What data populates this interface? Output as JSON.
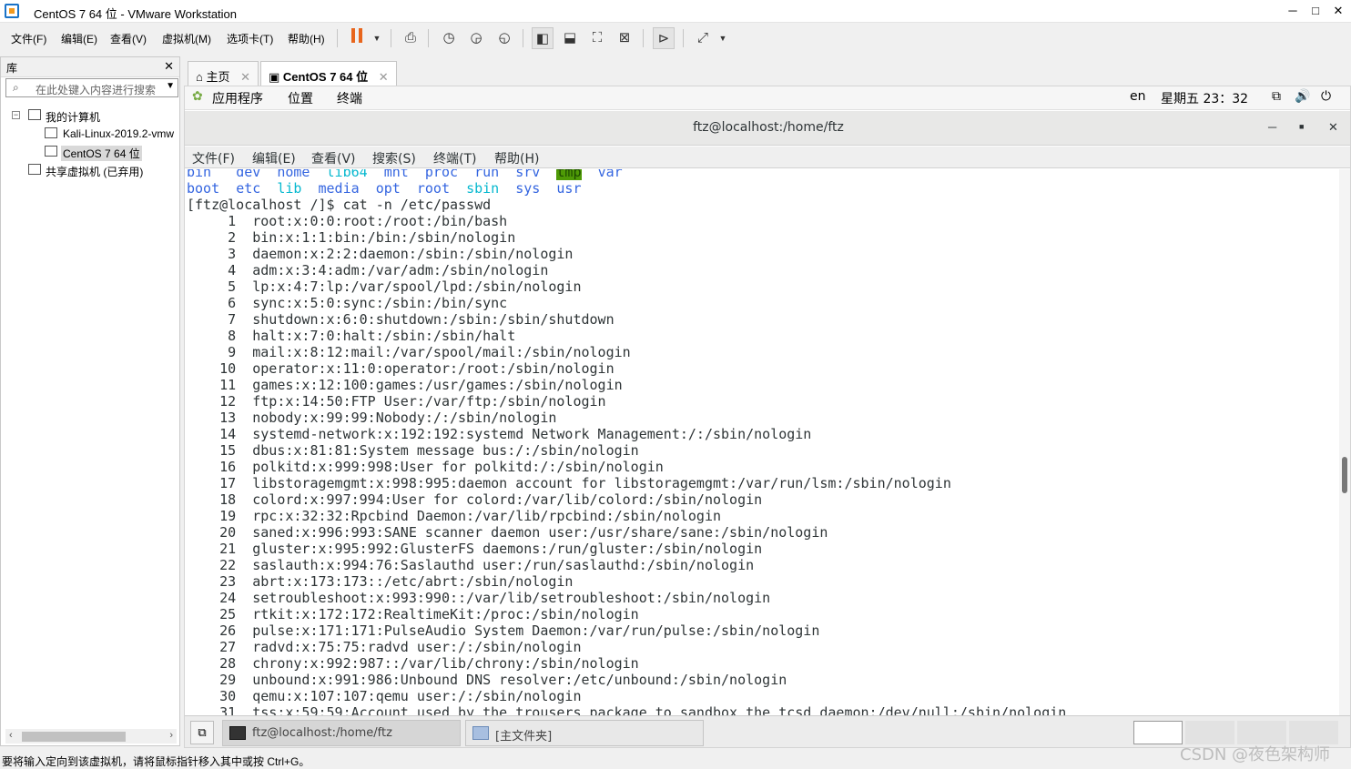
{
  "window": {
    "title": "CentOS 7 64 位 - VMware Workstation"
  },
  "menubar": {
    "items": [
      "文件(F)",
      "编辑(E)",
      "查看(V)",
      "虚拟机(M)",
      "选项卡(T)",
      "帮助(H)"
    ]
  },
  "toolbar": {
    "icons": [
      "pause-icon",
      "dropdown-icon",
      "send-ctrl-alt-del-icon",
      "snapshot-icon",
      "revert-snapshot-icon",
      "snapshot-manager-icon",
      "library-view-icon",
      "thumbnail-view-icon",
      "fullscreen-icon",
      "unity-icon",
      "console-view-icon",
      "stretch-icon",
      "dropdown-icon"
    ],
    "pause_color": "#e8651c"
  },
  "library": {
    "title": "库",
    "search_placeholder": "在此处键入内容进行搜索",
    "tree": [
      {
        "label": "我的计算机",
        "level": 0,
        "expander": "−"
      },
      {
        "label": "Kali-Linux-2019.2-vmw",
        "level": 1
      },
      {
        "label": "CentOS 7 64 位",
        "level": 1,
        "selected": true
      },
      {
        "label": "共享虚拟机 (已弃用)",
        "level": 0
      }
    ]
  },
  "tabs": [
    {
      "label": "主页",
      "icon": "home-icon"
    },
    {
      "label": "CentOS 7 64 位",
      "icon": "vm-icon",
      "active": true
    }
  ],
  "gnome": {
    "apps": "应用程序",
    "places": "位置",
    "terminal": "终端",
    "lang": "en",
    "clock": "星期五 23：32"
  },
  "terminal": {
    "title": "ftz@localhost:/home/ftz",
    "menu": [
      "文件(F)",
      "编辑(E)",
      "查看(V)",
      "搜索(S)",
      "终端(T)",
      "帮助(H)"
    ],
    "ls_row1": [
      "bin",
      "dev",
      "home",
      "lib64",
      "mnt",
      "proc",
      "run",
      "srv",
      "tmp",
      "var"
    ],
    "ls_row2": [
      "boot",
      "etc",
      "lib",
      "media",
      "opt",
      "root",
      "sbin",
      "sys",
      "usr"
    ],
    "prompt": "[ftz@localhost /]$ cat -n /etc/passwd",
    "lines": [
      "root:x:0:0:root:/root:/bin/bash",
      "bin:x:1:1:bin:/bin:/sbin/nologin",
      "daemon:x:2:2:daemon:/sbin:/sbin/nologin",
      "adm:x:3:4:adm:/var/adm:/sbin/nologin",
      "lp:x:4:7:lp:/var/spool/lpd:/sbin/nologin",
      "sync:x:5:0:sync:/sbin:/bin/sync",
      "shutdown:x:6:0:shutdown:/sbin:/sbin/shutdown",
      "halt:x:7:0:halt:/sbin:/sbin/halt",
      "mail:x:8:12:mail:/var/spool/mail:/sbin/nologin",
      "operator:x:11:0:operator:/root:/sbin/nologin",
      "games:x:12:100:games:/usr/games:/sbin/nologin",
      "ftp:x:14:50:FTP User:/var/ftp:/sbin/nologin",
      "nobody:x:99:99:Nobody:/:/sbin/nologin",
      "systemd-network:x:192:192:systemd Network Management:/:/sbin/nologin",
      "dbus:x:81:81:System message bus:/:/sbin/nologin",
      "polkitd:x:999:998:User for polkitd:/:/sbin/nologin",
      "libstoragemgmt:x:998:995:daemon account for libstoragemgmt:/var/run/lsm:/sbin/nologin",
      "colord:x:997:994:User for colord:/var/lib/colord:/sbin/nologin",
      "rpc:x:32:32:Rpcbind Daemon:/var/lib/rpcbind:/sbin/nologin",
      "saned:x:996:993:SANE scanner daemon user:/usr/share/sane:/sbin/nologin",
      "gluster:x:995:992:GlusterFS daemons:/run/gluster:/sbin/nologin",
      "saslauth:x:994:76:Saslauthd user:/run/saslauthd:/sbin/nologin",
      "abrt:x:173:173::/etc/abrt:/sbin/nologin",
      "setroubleshoot:x:993:990::/var/lib/setroubleshoot:/sbin/nologin",
      "rtkit:x:172:172:RealtimeKit:/proc:/sbin/nologin",
      "pulse:x:171:171:PulseAudio System Daemon:/var/run/pulse:/sbin/nologin",
      "radvd:x:75:75:radvd user:/:/sbin/nologin",
      "chrony:x:992:987::/var/lib/chrony:/sbin/nologin",
      "unbound:x:991:986:Unbound DNS resolver:/etc/unbound:/sbin/nologin",
      "qemu:x:107:107:qemu user:/:/sbin/nologin",
      "tss:x:59:59:Account used by the trousers package to sandbox the tcsd daemon:/dev/null:/sbin/nologin"
    ]
  },
  "taskbar": {
    "items": [
      "ftz@localhost:/home/ftz",
      "[主文件夹]"
    ]
  },
  "statusbar": {
    "text": "要将输入定向到该虚拟机，请将鼠标指针移入其中或按 Ctrl+G。",
    "watermark": "CSDN @夜色架构师"
  }
}
